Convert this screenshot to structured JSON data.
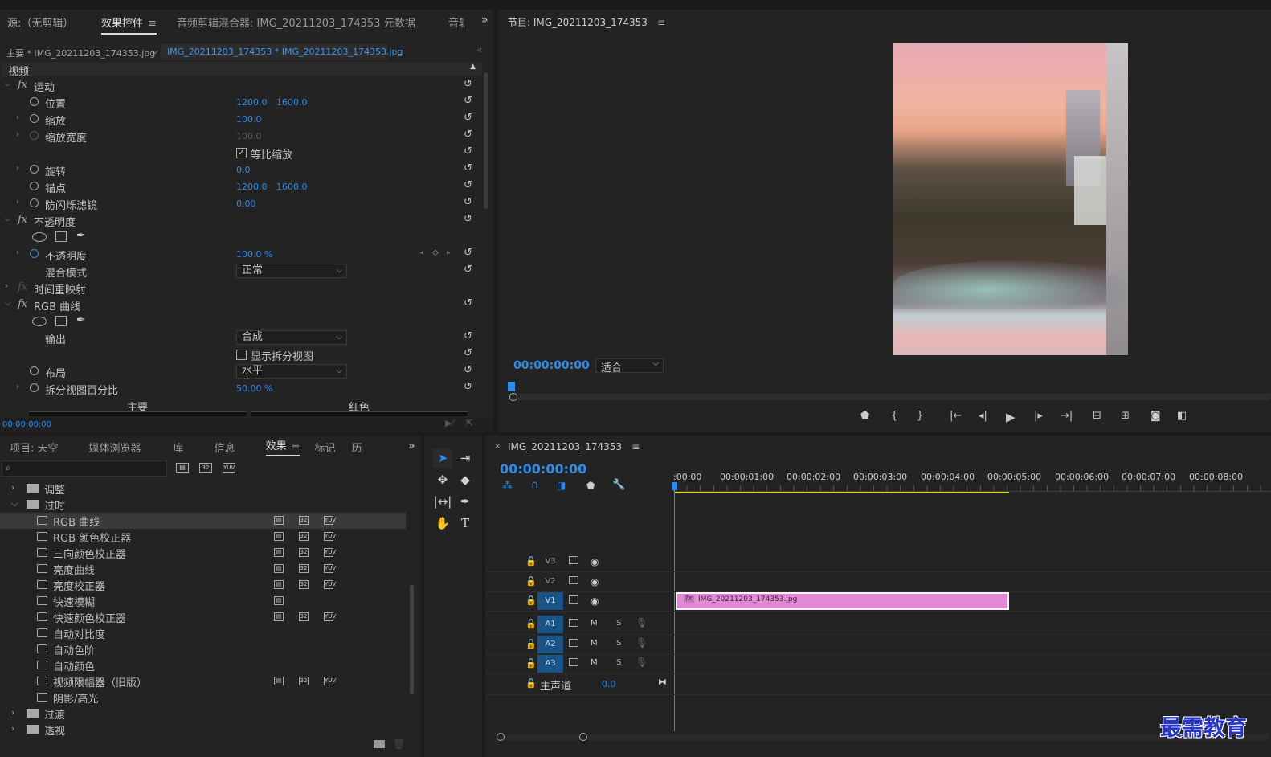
{
  "source_panel": {
    "title": "源:（无剪辑）",
    "tabs": [
      "效果控件",
      "音频剪辑混合器: IMG_20211203_174353",
      "元数据",
      "音轨"
    ]
  },
  "effect_controls": {
    "master": "主要 * IMG_20211203_174353.jpg",
    "clip": "IMG_20211203_174353 * IMG_20211203_174353.jpg",
    "section": "视频",
    "motion": "运动",
    "position_label": "位置",
    "position_x": "1200.0",
    "position_y": "1600.0",
    "scale_label": "缩放",
    "scale_val": "100.0",
    "scale_width_label": "缩放宽度",
    "scale_width_val": "100.0",
    "uniform_label": "等比缩放",
    "rotation_label": "旋转",
    "rotation_val": "0.0",
    "anchor_label": "锚点",
    "anchor_x": "1200.0",
    "anchor_y": "1600.0",
    "flicker_label": "防闪烁滤镜",
    "flicker_val": "0.00",
    "opacity_group": "不透明度",
    "opacity_label": "不透明度",
    "opacity_val": "100.0 %",
    "blend_label": "混合模式",
    "blend_val": "正常",
    "time_remap": "时间重映射",
    "rgb_curves": "RGB 曲线",
    "output_label": "输出",
    "output_val": "合成",
    "split_label": "显示拆分视图",
    "layout_label": "布局",
    "layout_val": "水平",
    "split_pct_label": "拆分视图百分比",
    "split_pct_val": "50.00 %",
    "curve_master": "主要",
    "curve_red": "红色",
    "timecode": "00:00:00:00"
  },
  "program": {
    "title": "节目: IMG_20211203_174353",
    "timecode": "00:00:00:00",
    "fit": "适合"
  },
  "project_panel": {
    "tabs": [
      "项目: 天空",
      "媒体浏览器",
      "库",
      "信息",
      "效果",
      "标记",
      "历"
    ]
  },
  "effects_tree": {
    "folders": [
      "调整",
      "过时",
      "过渡",
      "透视"
    ],
    "items": [
      "RGB 曲线",
      "RGB 颜色校正器",
      "三向颜色校正器",
      "亮度曲线",
      "亮度校正器",
      "快速模糊",
      "快速颜色校正器",
      "自动对比度",
      "自动色阶",
      "自动颜色",
      "视频限幅器（旧版）",
      "阴影/高光"
    ]
  },
  "timeline": {
    "title": "IMG_20211203_174353",
    "timecode": "00:00:00:00",
    "ruler": [
      ":00:00",
      "00:00:01:00",
      "00:00:02:00",
      "00:00:03:00",
      "00:00:04:00",
      "00:00:05:00",
      "00:00:06:00",
      "00:00:07:00",
      "00:00:08:00"
    ],
    "tracks": [
      "V3",
      "V2",
      "V1",
      "A1",
      "A2",
      "A3"
    ],
    "m": "M",
    "s": "S",
    "master_label": "主声道",
    "master_val": "0.0",
    "clip": "IMG_20211203_174353.jpg"
  },
  "watermark": "最需教育"
}
